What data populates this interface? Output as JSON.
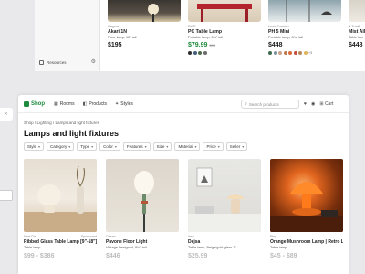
{
  "background_window": {
    "sidebar": {
      "resources_label": "Resources"
    },
    "cards": [
      {
        "brand": "Ikagura",
        "name": "Akari 1N",
        "desc": "Floor lamp, 15\" tall",
        "price": "$195",
        "old_price": "",
        "sale": false,
        "swatches": [],
        "more": ""
      },
      {
        "brand": "DWR",
        "name": "PC Table Lamp",
        "desc": "Portable lamp, 6¾\" tall",
        "price": "$79.99",
        "old_price": "$99",
        "sale": true,
        "swatches": [
          "#2e2e2e",
          "#3f5f7a",
          "#4e6a4a",
          "#6b6b6b"
        ],
        "more": ""
      },
      {
        "brand": "Louis Poulsen",
        "name": "PH 5 Mini",
        "desc": "Portable lamp, 8¾\" tall",
        "price": "$448",
        "old_price": "",
        "sale": false,
        "swatches": [
          "#3d6b4f",
          "#7a8f9c",
          "#c9a38a",
          "#c07a4a",
          "#d96a3a",
          "#c84d3d",
          "#b88a5a",
          "#e0b45a"
        ],
        "more": "+3"
      },
      {
        "brand": "& Traditi",
        "name": "Mist All",
        "desc": "Table lam",
        "price": "$448",
        "old_price": "",
        "sale": false,
        "swatches": [],
        "more": ""
      }
    ]
  },
  "topbar": {
    "logo": "Shop",
    "nav": [
      {
        "label": "Rooms",
        "icon": "rooms-icon"
      },
      {
        "label": "Products",
        "icon": "products-icon"
      },
      {
        "label": "Styles",
        "icon": "styles-icon"
      }
    ],
    "search_placeholder": "Search products",
    "cart_label": "Cart"
  },
  "breadcrumb": "Shop  /  Lighting  /  Lamps and light fixtures",
  "page_title": "Lamps and light fixtures",
  "filters": [
    "Style",
    "Category",
    "Type",
    "Color",
    "Features",
    "Size",
    "Material",
    "Price",
    "Seller"
  ],
  "products": [
    {
      "seller": "Nest Din",
      "badge": "Sponsored",
      "name": "Ribbed Glass Table Lamp [9\"-18\"]",
      "desc": "Table lamp",
      "price": "$99 - $386"
    },
    {
      "seller": "Gesen",
      "badge": "",
      "name": "Pavone Floor Light",
      "desc": "Vintage Designed, 9¾\" tall",
      "price": "$446"
    },
    {
      "seller": "Ikea",
      "badge": "",
      "name": "Dejsa",
      "desc": "Table lamp, Beige/gold glass 7\"",
      "price": "$25.99"
    },
    {
      "seller": "Etsy",
      "badge": "",
      "name": "Orange Mushroom Lamp | Retro L",
      "desc": "Table lamp",
      "price": "$45 - $89"
    }
  ],
  "colors": {
    "accent": "#1e8a3c",
    "sale": "#1e8a3c"
  }
}
